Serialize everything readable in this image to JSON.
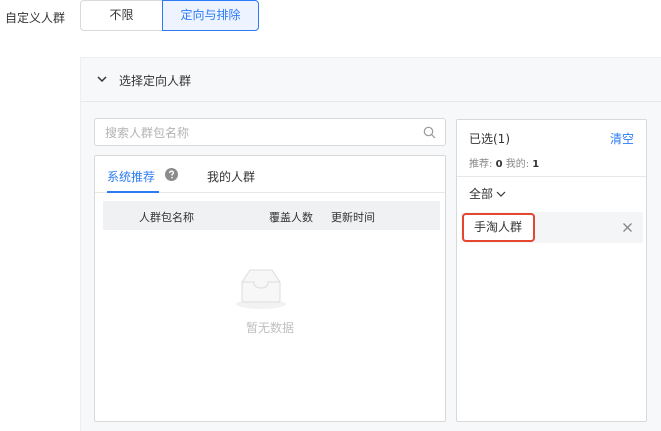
{
  "audience": {
    "label": "自定义人群",
    "options": [
      "不限",
      "定向与排除"
    ],
    "selected": "定向与排除"
  },
  "panel": {
    "title": "选择定向人群"
  },
  "search": {
    "placeholder": "搜索人群包名称",
    "value": ""
  },
  "tabs": {
    "active": "系统推荐",
    "other": "我的人群"
  },
  "table": {
    "columns": [
      "人群包名称",
      "覆盖人数",
      "更新时间"
    ],
    "empty_text": "暂无数据"
  },
  "selected_panel": {
    "title": "已选(1)",
    "clear_label": "清空",
    "stats": {
      "recommended_label": "推荐:",
      "recommended_count": "0",
      "mine_label": "我的:",
      "mine_count": "1"
    },
    "filter_label": "全部",
    "items": [
      {
        "label": "手淘人群"
      }
    ]
  },
  "colors": {
    "accent": "#2d7bf4",
    "highlight_border": "#e5462f",
    "panel_bg": "#f7f8fa"
  }
}
